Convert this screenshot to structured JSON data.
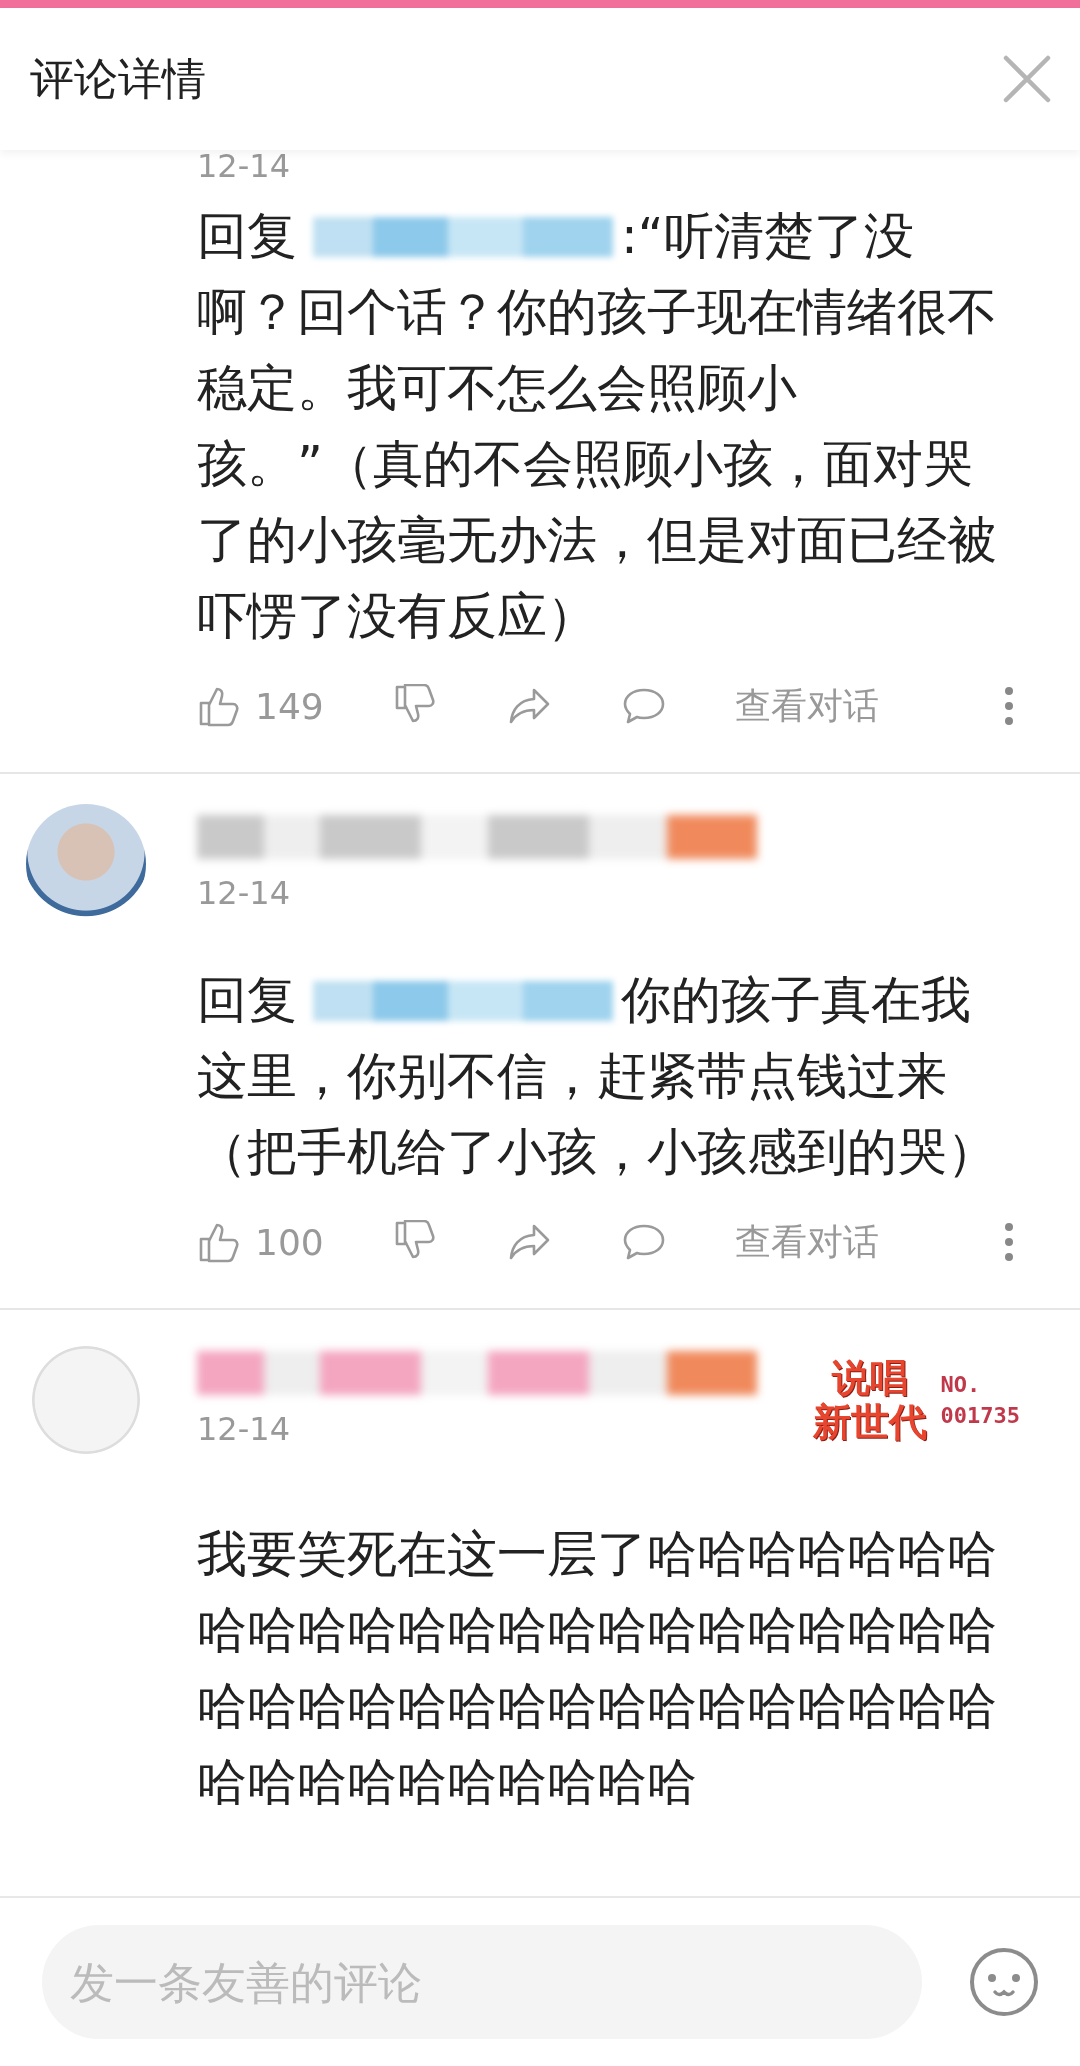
{
  "header": {
    "title": "评论详情"
  },
  "comments": [
    {
      "kind": "cut_top",
      "date": "12-14",
      "reply_prefix": "回复",
      "text": ":“听清楚了没啊？回个话？你的孩子现在情绪很不稳定。我可不怎么会照顾小孩。”（真的不会照顾小孩，面对哭了的小孩毫无办法，但是对面已经被吓愣了没有反应）",
      "actions": {
        "likes": "149",
        "view_dialog": "查看对话"
      }
    },
    {
      "kind": "full",
      "color": "#c9c9c9",
      "date": "12-14",
      "reply_prefix": "回复",
      "text": "你的孩子真在我这里，你别不信，赶紧带点钱过来（把手机给了小孩，小孩感到的哭）",
      "actions": {
        "likes": "100",
        "view_dialog": "查看对话"
      }
    },
    {
      "kind": "full",
      "color": "#f4a6c0",
      "date": "12-14",
      "badge": {
        "title_lines": [
          "说唱",
          "新世代"
        ],
        "label": "NO.",
        "number": "001735"
      },
      "text": "我要笑死在这一层了哈哈哈哈哈哈哈哈哈哈哈哈哈哈哈哈哈哈哈哈哈哈哈哈哈哈哈哈哈哈哈哈哈哈哈哈哈哈哈哈哈哈哈哈哈哈哈哈哈"
    }
  ],
  "composer": {
    "placeholder": "发一条友善的评论"
  }
}
